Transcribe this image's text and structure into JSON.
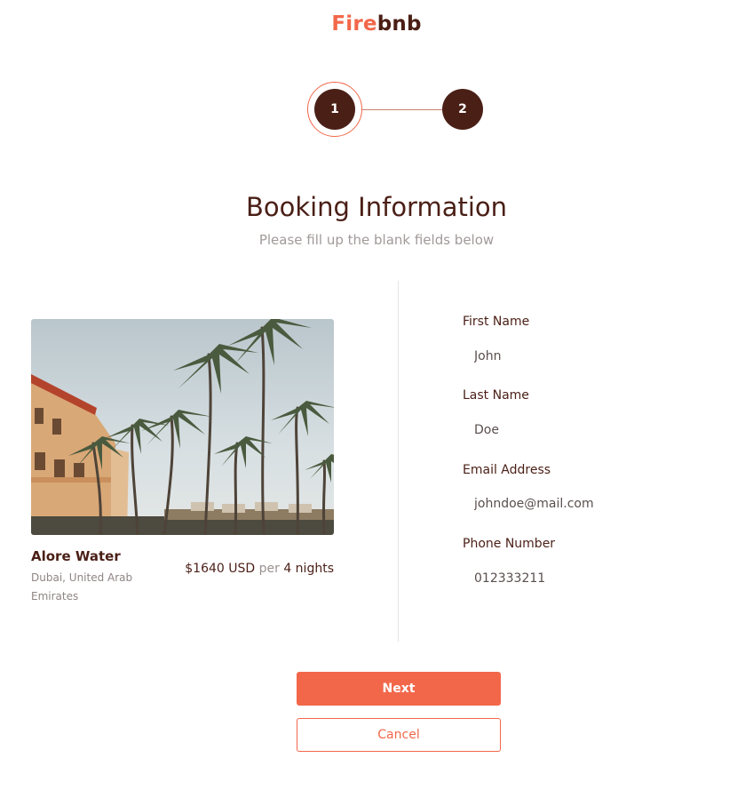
{
  "brand": {
    "part1": "Fire",
    "part2": "bnb"
  },
  "stepper": {
    "steps": [
      "1",
      "2"
    ],
    "active_step": "1"
  },
  "heading": {
    "title": "Booking Information",
    "subtitle": "Please fill up the blank fields below"
  },
  "property": {
    "name": "Alore Water",
    "location": "Dubai, United Arab Emirates",
    "price": "$1640 USD",
    "per": "per",
    "nights": "4 nights",
    "image_icon": "photo-palm-trees-resort"
  },
  "form": {
    "first_name": {
      "label": "First Name",
      "value": "John"
    },
    "last_name": {
      "label": "Last Name",
      "value": "Doe"
    },
    "email": {
      "label": "Email Address",
      "value": "johndoe@mail.com"
    },
    "phone": {
      "label": "Phone Number",
      "value": "012333211"
    }
  },
  "buttons": {
    "next": "Next",
    "cancel": "Cancel"
  },
  "colors": {
    "accent": "#f2674a",
    "dark": "#4a1f16",
    "muted": "#a19a99"
  }
}
